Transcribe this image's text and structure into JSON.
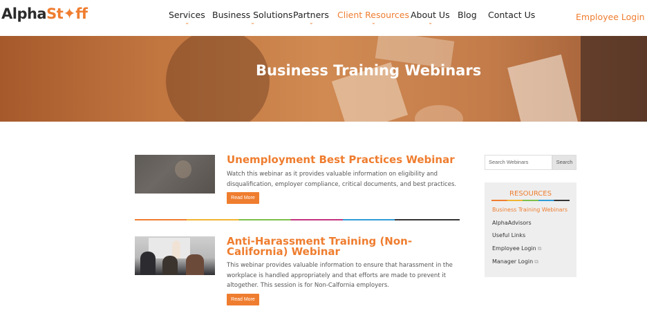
{
  "header": {
    "logo_part1": "Alpha",
    "logo_part2": "St",
    "logo_star": "✦",
    "logo_part3": "ff",
    "nav": [
      {
        "label": "Services",
        "has_dropdown": true
      },
      {
        "label": "Business Solutions",
        "has_dropdown": true
      },
      {
        "label": "Partners",
        "has_dropdown": true
      },
      {
        "label": "Client Resources",
        "has_dropdown": true,
        "active": true
      },
      {
        "label": "About Us",
        "has_dropdown": true
      },
      {
        "label": "Blog",
        "has_dropdown": false
      },
      {
        "label": "Contact Us",
        "has_dropdown": false
      }
    ],
    "login_label": "Employee Login",
    "login_chevron": "⌄"
  },
  "hero": {
    "title": "Business Training Webinars"
  },
  "posts": [
    {
      "title": "Unemployment Best Practices Webinar",
      "excerpt": "Watch this webinar as it provides valuable information on eligibility and disqualification, employer compliance, critical documents, and best practices.",
      "button": "Read More"
    },
    {
      "title": "Anti-Harassment Training (Non-California) Webinar",
      "excerpt": "This webinar provides valuable information to ensure that harassment in the workplace is handled appropriately and that efforts are made to prevent it altogether. This session is for Non-Calfornia employers.",
      "button": "Read More"
    }
  ],
  "sidebar": {
    "search_placeholder": "Search Webinars",
    "search_button": "Search",
    "resources_title": "RESOURCES",
    "items": [
      {
        "label": "Business Training Webinars",
        "active": true,
        "external": false
      },
      {
        "label": "AlphaAdvisors",
        "active": false,
        "external": false
      },
      {
        "label": "Useful Links",
        "active": false,
        "external": false
      },
      {
        "label": "Employee Login",
        "active": false,
        "external": true
      },
      {
        "label": "Manager Login",
        "active": false,
        "external": true
      }
    ],
    "external_icon": "⧉"
  },
  "colors": {
    "accent": "#ef7d2f",
    "text": "#333333",
    "sidebar_bg": "#eeeeee"
  }
}
